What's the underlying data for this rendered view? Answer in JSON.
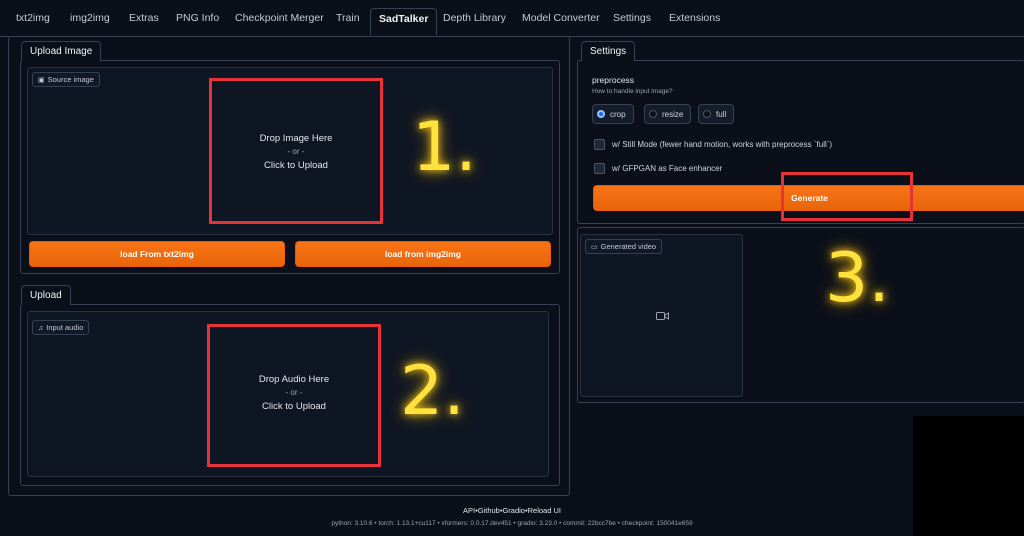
{
  "tabs": [
    "txt2img",
    "img2img",
    "Extras",
    "PNG Info",
    "Checkpoint Merger",
    "Train",
    "SadTalker",
    "Depth Library",
    "Model Converter",
    "Settings",
    "Extensions"
  ],
  "upload_image": {
    "tab_label": "Upload Image",
    "chip_label": "Source image",
    "drop_line1": "Drop Image Here",
    "drop_or": "- or -",
    "drop_line2": "Click to Upload",
    "annotation": "1.",
    "btn_txt2img": "load From txt2img",
    "btn_img2img": "load from img2img"
  },
  "upload_audio": {
    "tab_label": "Upload",
    "chip_label": "Input audio",
    "drop_line1": "Drop Audio Here",
    "drop_or": "- or -",
    "drop_line2": "Click to Upload",
    "annotation": "2."
  },
  "settings": {
    "tab_label": "Settings",
    "preprocess_label": "preprocess",
    "preprocess_hint": "How to handle input image?",
    "options": [
      "crop",
      "resize",
      "full"
    ],
    "selected": "crop",
    "still_mode": "w/ Still Mode (fewer hand motion, works with preprocess `full`)",
    "gfpgan": "w/ GFPGAN as Face enhancer",
    "generate": "Generate",
    "video_chip": "Generated video",
    "annotation": "3."
  },
  "footer": {
    "links": "API•Github•Gradio•Reload UI",
    "versions": "python: 3.10.6  •  torch: 1.13.1+cu117  •  xformers: 0.0.17.dev451  •  gradio: 3.23.0  •  commit: 22bcc7be  •  checkpoint: 150041e659"
  },
  "colors": {
    "accent_orange": "#f97316",
    "highlight_red": "#e8323a",
    "annotation_yellow": "#ffe23d",
    "background": "#0b0f19"
  }
}
